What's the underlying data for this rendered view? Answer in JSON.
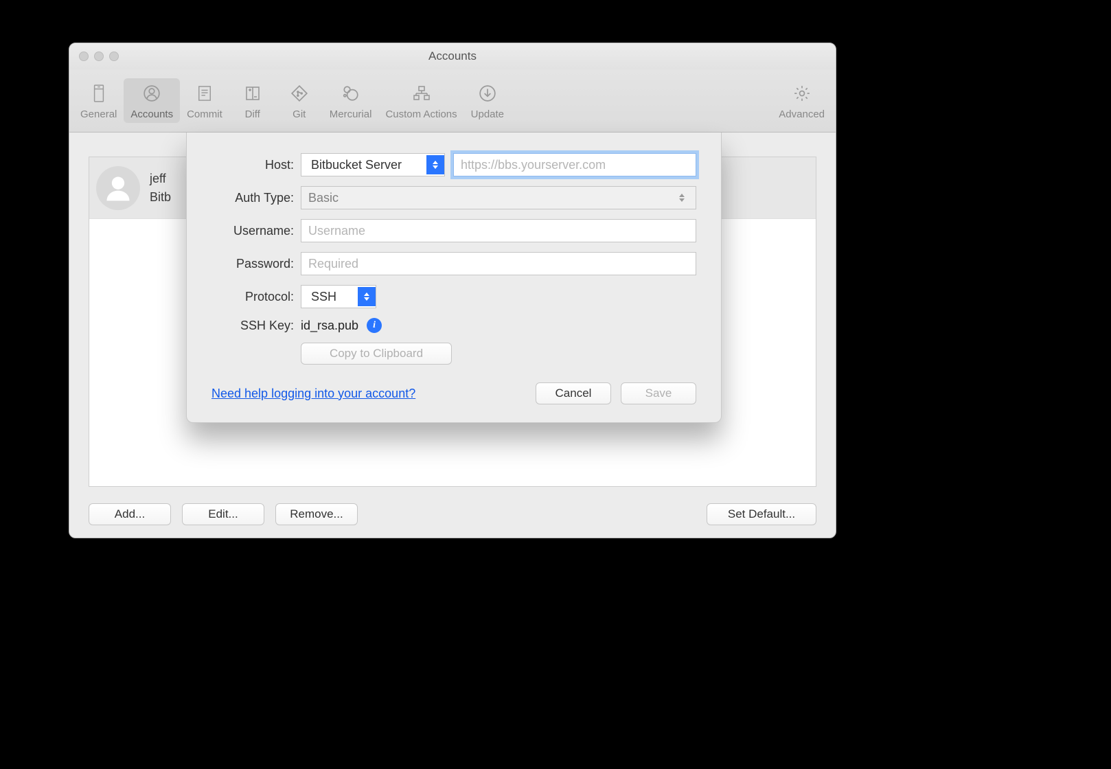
{
  "titlebar": {
    "title": "Accounts"
  },
  "toolbar": {
    "items": [
      {
        "label": "General"
      },
      {
        "label": "Accounts"
      },
      {
        "label": "Commit"
      },
      {
        "label": "Diff"
      },
      {
        "label": "Git"
      },
      {
        "label": "Mercurial"
      },
      {
        "label": "Custom Actions"
      },
      {
        "label": "Update"
      }
    ],
    "advanced": "Advanced"
  },
  "accounts_list": {
    "items": [
      {
        "name": "jeff",
        "subtitle": "Bitb"
      }
    ]
  },
  "buttons": {
    "add": "Add...",
    "edit": "Edit...",
    "remove": "Remove...",
    "set_default": "Set Default..."
  },
  "sheet": {
    "labels": {
      "host": "Host:",
      "auth_type": "Auth Type:",
      "username": "Username:",
      "password": "Password:",
      "protocol": "Protocol:",
      "ssh_key": "SSH Key:"
    },
    "host_select": "Bitbucket Server",
    "host_url_placeholder": "https://bbs.yourserver.com",
    "auth_type_value": "Basic",
    "username_placeholder": "Username",
    "password_placeholder": "Required",
    "protocol_value": "SSH",
    "ssh_key_value": "id_rsa.pub",
    "copy_btn": "Copy to Clipboard",
    "help_link": "Need help logging into your account?",
    "cancel": "Cancel",
    "save": "Save"
  }
}
